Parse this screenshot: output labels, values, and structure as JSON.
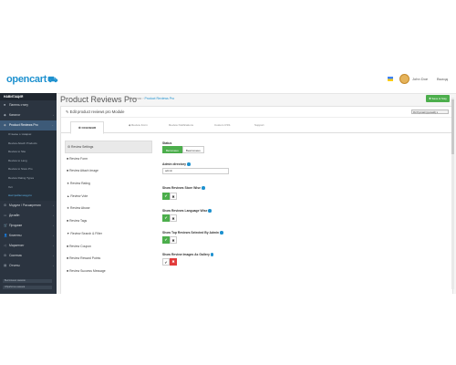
{
  "app": {
    "logo": "opencart",
    "logo_mark": "⛟",
    "user": "John Doe",
    "logout": "Выход"
  },
  "sidebar": {
    "title": "НАВИГАЦИЯ",
    "items": [
      {
        "icon": "■",
        "label": "Панель стату",
        "arrow": ""
      },
      {
        "icon": "◆",
        "label": "Каталог",
        "arrow": "›"
      },
      {
        "icon": "◆",
        "label": "Product Reviews Pro",
        "arrow": "⌄"
      }
    ],
    "subitems": [
      "Отзывы о товарах",
      "Review Attach Products",
      "Review to Site",
      "Review to Lang",
      "Review to Store Pro",
      "Review Rating Types",
      "Хит",
      "Настройки модуля"
    ],
    "more_items": [
      {
        "icon": "⚙",
        "label": "Модули / Расширения",
        "arrow": "›"
      },
      {
        "icon": "▭",
        "label": "Дизайн",
        "arrow": "›"
      },
      {
        "icon": "🛒",
        "label": "Продажи",
        "arrow": "›"
      },
      {
        "icon": "👤",
        "label": "Клиенты",
        "arrow": "›"
      },
      {
        "icon": "◁",
        "label": "Маркетинг",
        "arrow": "›"
      },
      {
        "icon": "⚙",
        "label": "Система",
        "arrow": "›"
      },
      {
        "icon": "▤",
        "label": "Отчеты",
        "arrow": "›"
      }
    ],
    "stats": [
      "Выполнено заказов",
      "Обработка заказов"
    ]
  },
  "main": {
    "title": "Product Reviews Pro",
    "crumb_home": "Главная",
    "crumb_sep": "›",
    "crumb_current": "Product Reviews Pro",
    "save_label": "✚ Save & Stay",
    "panel_title": "✎ Edit product reviews pro Module",
    "language_select": "RU  Русский (русский)  ▾",
    "tabs": [
      "⚙  ОСНОВНЯ",
      "◆ Review Form",
      "Review Notifications",
      "Custom CSS",
      "Support"
    ]
  },
  "left_nav": [
    {
      "icon": "⚙",
      "label": "Review Settings"
    },
    {
      "icon": "■",
      "label": "Review Form"
    },
    {
      "icon": "■",
      "label": "Review Attach Image"
    },
    {
      "icon": "★",
      "label": "Review Rating"
    },
    {
      "icon": "▲",
      "label": "Review Vote"
    },
    {
      "icon": "★",
      "label": "Review Abuse"
    },
    {
      "icon": "■",
      "label": "Review Tags"
    },
    {
      "icon": "▼",
      "label": "Review Search & Filter"
    },
    {
      "icon": "■",
      "label": "Review Coupon"
    },
    {
      "icon": "■",
      "label": "Review Reward Points"
    },
    {
      "icon": "■",
      "label": "Review Success Message"
    }
  ],
  "settings": {
    "status_label": "Status",
    "status_on": "Включено",
    "status_off": "Выключено",
    "admin_dir_label": "Admin directory",
    "admin_dir_value": "admin",
    "store_wise_label": "Show Reviews Store Wise",
    "lang_wise_label": "Show Reviews Language Wise",
    "top_reviews_label": "Show Top Reviews Selected By Admin",
    "images_gallery_label": "Show Review Images As Gallery",
    "check": "✔",
    "cross": "✖"
  },
  "colors": {
    "accent": "#1e91cf",
    "success": "#4cae4c",
    "danger": "#e23b3b",
    "sidebar": "#2b3440"
  }
}
